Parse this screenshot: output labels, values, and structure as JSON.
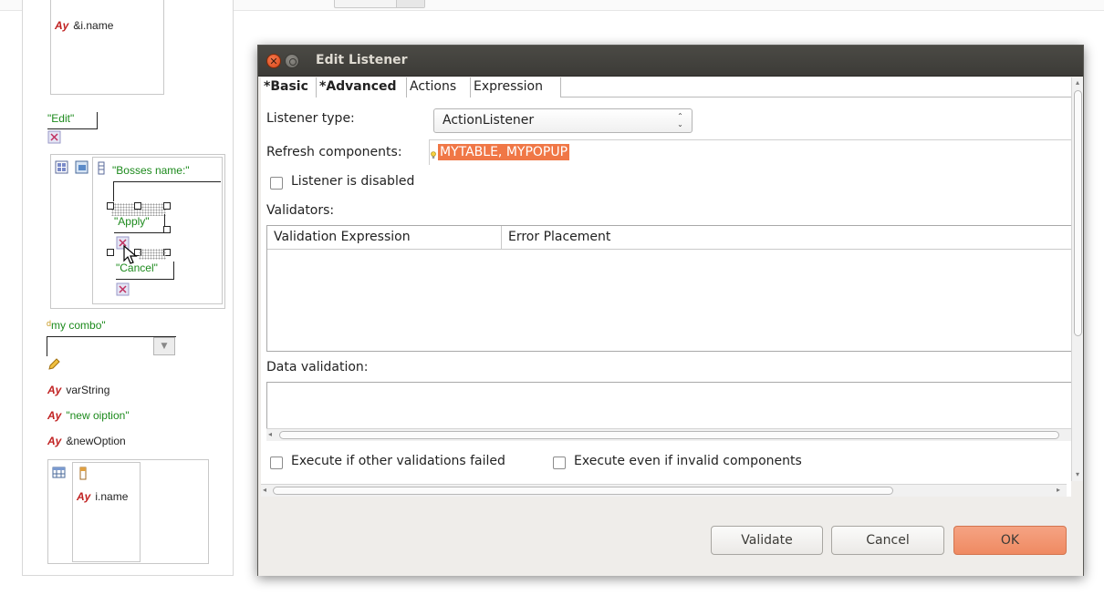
{
  "canvas": {
    "labels": {
      "i_name_ref": "&i.name",
      "edit_btn": "\"Edit\"",
      "bosses_name": "\"Bosses name:\"",
      "apply_btn": "\"Apply\"",
      "cancel_btn": "\"Cancel\"",
      "my_combo": "my combo\"",
      "var_string": "varString",
      "new_option_literal": "\"new oiption\"",
      "new_option_ref": "&newOption",
      "i_name": "i.name"
    },
    "ay_prefix": "Ay"
  },
  "dialog": {
    "title": "Edit Listener",
    "close_glyph": "✕",
    "tabs": [
      "*Basic",
      "*Advanced",
      "Actions",
      "Expression"
    ],
    "listener_type_label": "Listener type:",
    "listener_type_value": "ActionListener",
    "spin_glyph": "⌃⌄",
    "refresh_label": "Refresh components:",
    "refresh_value": "MYTABLE, MYPOPUP",
    "disabled_label": "Listener is disabled",
    "validators_label": "Validators:",
    "columns": [
      "Validation Expression",
      "Error Placement"
    ],
    "data_validation_label": "Data validation:",
    "exec_failed_label": "Execute if other validations failed",
    "exec_invalid_label": "Execute even if invalid components",
    "buttons": {
      "validate": "Validate",
      "cancel": "Cancel",
      "ok": "OK"
    }
  },
  "colors": {
    "accent": "#f07746",
    "titlebar": "#3c3b37",
    "literal_green": "#1c8a1c",
    "ay_red": "#c02020"
  }
}
